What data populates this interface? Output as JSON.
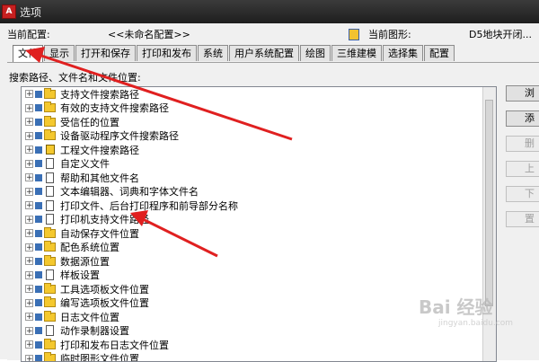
{
  "window": {
    "title": "选项",
    "icon": "autocad-logo-icon"
  },
  "profile": {
    "label": "当前配置:",
    "value": "<<未命名配置>>",
    "drawing_label": "当前图形:",
    "drawing_value": "D5地块开闭..."
  },
  "tabs": [
    {
      "label": "文件",
      "active": true
    },
    {
      "label": "显示"
    },
    {
      "label": "打开和保存"
    },
    {
      "label": "打印和发布"
    },
    {
      "label": "系统"
    },
    {
      "label": "用户系统配置"
    },
    {
      "label": "绘图"
    },
    {
      "label": "三维建模"
    },
    {
      "label": "选择集"
    },
    {
      "label": "配置"
    }
  ],
  "tree": {
    "label": "搜索路径、文件名和文件位置:",
    "items": [
      {
        "label": "支持文件搜索路径",
        "icon": "folder-icon"
      },
      {
        "label": "有效的支持文件搜索路径",
        "icon": "folder-icon"
      },
      {
        "label": "受信任的位置",
        "icon": "folder-icon"
      },
      {
        "label": "设备驱动程序文件搜索路径",
        "icon": "folder-icon"
      },
      {
        "label": "工程文件搜索路径",
        "icon": "project-icon"
      },
      {
        "label": "自定义文件",
        "icon": "file-icon"
      },
      {
        "label": "帮助和其他文件名",
        "icon": "file-icon"
      },
      {
        "label": "文本编辑器、词典和字体文件名",
        "icon": "file-icon"
      },
      {
        "label": "打印文件、后台打印程序和前导部分名称",
        "icon": "file-icon"
      },
      {
        "label": "打印机支持文件路径",
        "icon": "file-icon"
      },
      {
        "label": "自动保存文件位置",
        "icon": "folder-icon"
      },
      {
        "label": "配色系统位置",
        "icon": "folder-icon"
      },
      {
        "label": "数据源位置",
        "icon": "folder-icon"
      },
      {
        "label": "样板设置",
        "icon": "file-icon"
      },
      {
        "label": "工具选项板文件位置",
        "icon": "folder-icon"
      },
      {
        "label": "编写选项板文件位置",
        "icon": "folder-icon"
      },
      {
        "label": "日志文件位置",
        "icon": "folder-icon"
      },
      {
        "label": "动作录制器设置",
        "icon": "file-icon"
      },
      {
        "label": "打印和发布日志文件位置",
        "icon": "folder-icon"
      },
      {
        "label": "临时图形文件位置",
        "icon": "folder-icon"
      }
    ]
  },
  "buttons": {
    "browse": "浏",
    "add": "添",
    "b3": "删",
    "b4": "上",
    "b5": "下",
    "b6": "置"
  },
  "watermark": {
    "main": "Bai 经验",
    "sub": "jingyan.baidu.com"
  },
  "colors": {
    "arrow": "#e02020",
    "titlebar": "#2a2a2a"
  }
}
